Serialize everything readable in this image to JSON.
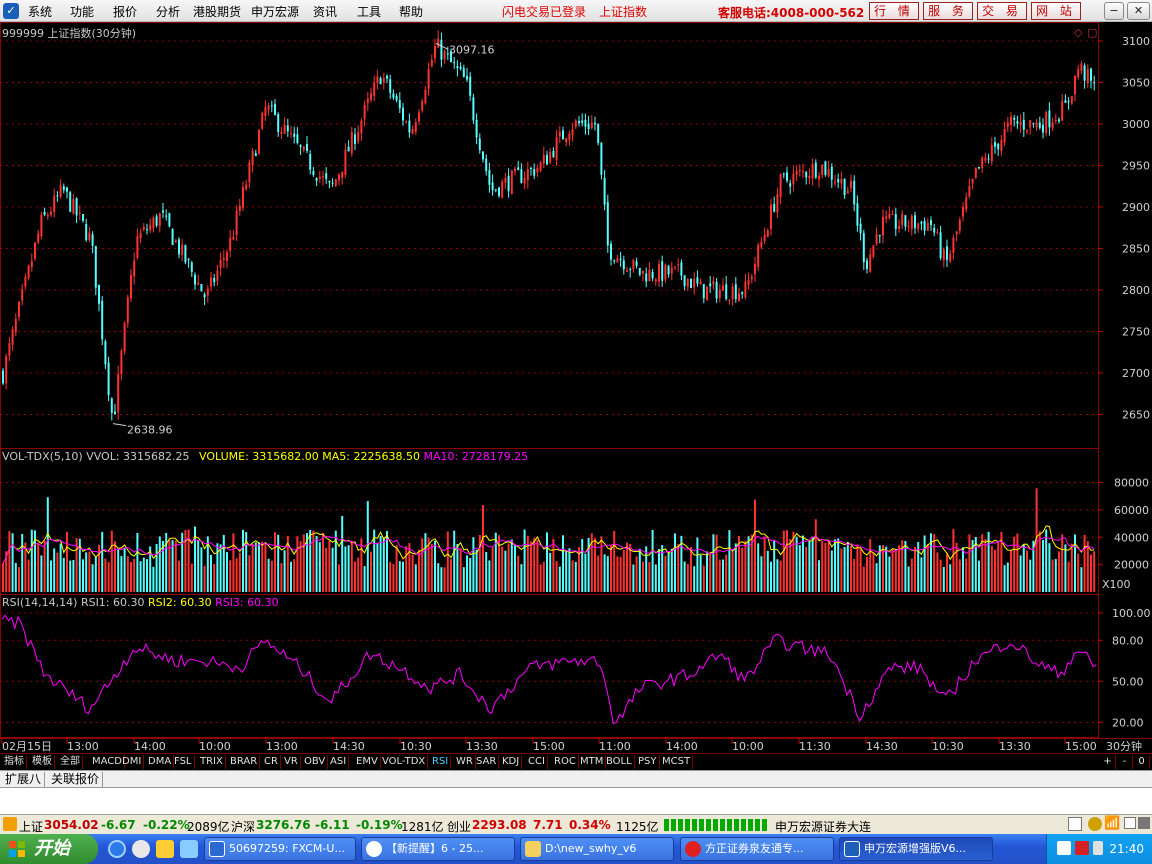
{
  "menubar": {
    "items": [
      "系统",
      "功能",
      "报价",
      "分析",
      "港股期货",
      "申万宏源",
      "资讯",
      "工具",
      "帮助"
    ],
    "status": "闪电交易已登录",
    "index_name": "上证指数",
    "hotline": "客服电话:4008-000-562",
    "nav_buttons": [
      "行 情",
      "服 务",
      "交 易",
      "网 站"
    ]
  },
  "main_chart": {
    "header": "999999 上证指数(30分钟)",
    "high_label": "3097.16",
    "low_label": "2638.96",
    "ticks": [
      "3100",
      "3050",
      "3000",
      "2950",
      "2900",
      "2850",
      "2800",
      "2750",
      "2700",
      "2650"
    ],
    "range": [
      2612,
      3118
    ]
  },
  "volume_panel": {
    "name": "VOL-TDX(5,10)",
    "vvol": "VVOL: 3315682.25",
    "volume": "VOLUME: 3315682.00",
    "ma5": "MA5: 2225638.50",
    "ma10": "MA10: 2728179.25",
    "ticks": [
      "80000",
      "60000",
      "40000",
      "20000"
    ],
    "multiplier": "X100"
  },
  "rsi_panel": {
    "name": "RSI(14,14,14)",
    "rsi1": "RSI1: 60.30",
    "rsi2": "RSI2: 60.30",
    "rsi3": "RSI3: 60.30",
    "ticks": [
      "100.00",
      "80.00",
      "50.00",
      "20.00"
    ]
  },
  "time_axis": {
    "labels": [
      "02月15日",
      "13:00",
      "14:00",
      "10:00",
      "13:00",
      "14:30",
      "10:30",
      "13:30",
      "15:00",
      "11:00",
      "14:00",
      "10:00",
      "11:30",
      "14:30",
      "10:30",
      "13:30",
      "15:00"
    ],
    "period": "30分钟"
  },
  "indicators": {
    "tabs": [
      "指标",
      "模板",
      "全部",
      "MACD",
      "DMI",
      "DMA",
      "FSL",
      "TRIX",
      "BRAR",
      "CR",
      "VR",
      "OBV",
      "ASI",
      "EMV",
      "VOL-TDX",
      "RSI",
      "WR",
      "SAR",
      "KDJ",
      "CCI",
      "ROC",
      "MTM",
      "BOLL",
      "PSY",
      "MCST"
    ],
    "active": "RSI",
    "controls": [
      "+",
      "-",
      "0"
    ]
  },
  "ext_tabs": [
    "扩展八",
    "关联报价"
  ],
  "quote_bar": {
    "sh_label": "上证",
    "sh_value": "3054.02",
    "sh_change": "-6.67",
    "sh_pct": "-0.22%",
    "sh_amount": "2089亿",
    "hs_label": "沪深",
    "hs_value": "3276.76",
    "hs_change": "-6.11",
    "hs_pct": "-0.19%",
    "hs_amount": "1281亿",
    "cy_label": "创业",
    "cy_value": "2293.08",
    "cy_change": "7.71",
    "cy_pct": "0.34%",
    "cy_amount": "1125亿",
    "broker": "申万宏源证券大连"
  },
  "taskbar": {
    "start": "开始",
    "tasks": [
      "50697259: FXCM-U...",
      "【新提醒】6 - 25...",
      "D:\\new_swhy_v6",
      "方正证券泉友通专...",
      "申万宏源增强版V6..."
    ],
    "clock": "21:40"
  },
  "colors": {
    "up": "#ff3232",
    "down": "#54ffff",
    "ma5": "#ffff00",
    "ma10": "#ff00ff",
    "rsi": "#ff00ff",
    "grid": "#8b0000"
  }
}
